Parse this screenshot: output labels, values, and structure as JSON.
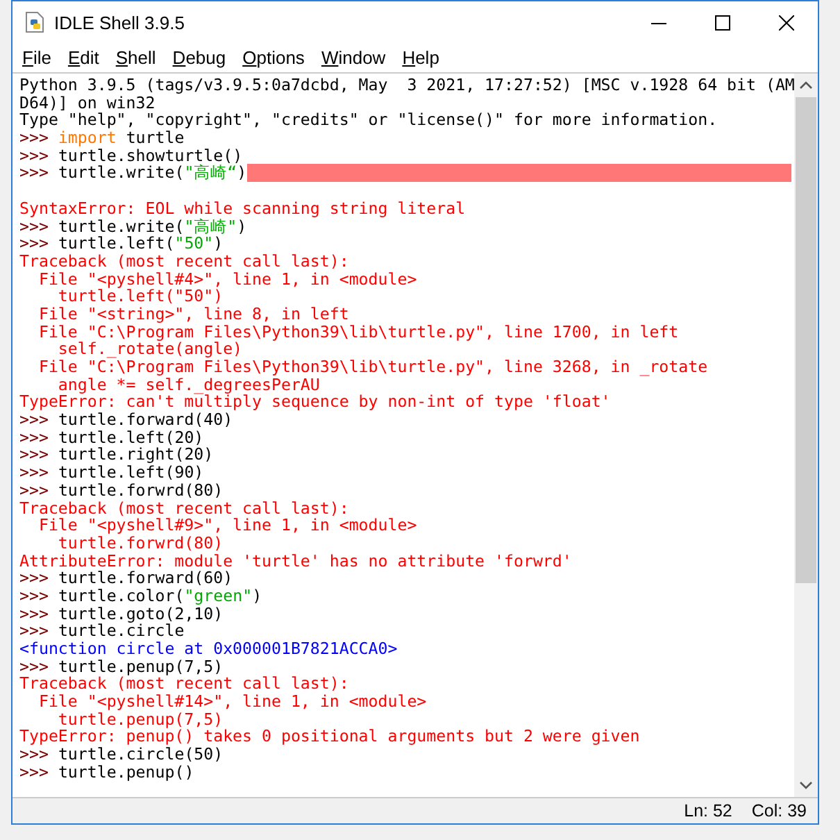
{
  "window": {
    "title": "IDLE Shell 3.9.5"
  },
  "menu": [
    "File",
    "Edit",
    "Shell",
    "Debug",
    "Options",
    "Window",
    "Help"
  ],
  "lines": [
    {
      "segments": [
        {
          "kind": "info",
          "text": "Python 3.9.5 (tags/v3.9.5:0a7dcbd, May  3 2021, 17:27:52) [MSC v.1928 64 bit (AM"
        }
      ]
    },
    {
      "segments": [
        {
          "kind": "info",
          "text": "D64)] on win32"
        }
      ]
    },
    {
      "segments": [
        {
          "kind": "info",
          "text": "Type \"help\", \"copyright\", \"credits\" or \"license()\" for more information."
        }
      ]
    },
    {
      "prompt": ">>>",
      "segments": [
        {
          "kind": "keyword",
          "text": "import"
        },
        {
          "kind": "code",
          "text": " turtle"
        }
      ]
    },
    {
      "prompt": ">>>",
      "segments": [
        {
          "kind": "code",
          "text": "turtle.showturtle()"
        }
      ]
    },
    {
      "prompt": ">>>",
      "segments": [
        {
          "kind": "code",
          "text": "turtle.write("
        },
        {
          "kind": "string",
          "text": "\"高崎“"
        },
        {
          "kind": "code",
          "text": ")"
        },
        {
          "kind": "error_mark"
        }
      ],
      "blank_line_after": true
    },
    {
      "segments": [
        {
          "kind": "error",
          "text": "SyntaxError: EOL while scanning string literal"
        }
      ]
    },
    {
      "prompt": ">>>",
      "segments": [
        {
          "kind": "code",
          "text": "turtle.write("
        },
        {
          "kind": "string",
          "text": "\"高崎\""
        },
        {
          "kind": "code",
          "text": ")"
        }
      ]
    },
    {
      "prompt": ">>>",
      "segments": [
        {
          "kind": "code",
          "text": "turtle.left("
        },
        {
          "kind": "string",
          "text": "\"50\""
        },
        {
          "kind": "code",
          "text": ")"
        }
      ]
    },
    {
      "segments": [
        {
          "kind": "error",
          "text": "Traceback (most recent call last):"
        }
      ]
    },
    {
      "segments": [
        {
          "kind": "error",
          "text": "  File \"<pyshell#4>\", line 1, in <module>"
        }
      ]
    },
    {
      "segments": [
        {
          "kind": "error",
          "text": "    turtle.left(\"50\")"
        }
      ]
    },
    {
      "segments": [
        {
          "kind": "error",
          "text": "  File \"<string>\", line 8, in left"
        }
      ]
    },
    {
      "segments": [
        {
          "kind": "error",
          "text": "  File \"C:\\Program Files\\Python39\\lib\\turtle.py\", line 1700, in left"
        }
      ]
    },
    {
      "segments": [
        {
          "kind": "error",
          "text": "    self._rotate(angle)"
        }
      ]
    },
    {
      "segments": [
        {
          "kind": "error",
          "text": "  File \"C:\\Program Files\\Python39\\lib\\turtle.py\", line 3268, in _rotate"
        }
      ]
    },
    {
      "segments": [
        {
          "kind": "error",
          "text": "    angle *= self._degreesPerAU"
        }
      ]
    },
    {
      "segments": [
        {
          "kind": "error",
          "text": "TypeError: can't multiply sequence by non-int of type 'float'"
        }
      ]
    },
    {
      "prompt": ">>>",
      "segments": [
        {
          "kind": "code",
          "text": "turtle.forward(40)"
        }
      ]
    },
    {
      "prompt": ">>>",
      "segments": [
        {
          "kind": "code",
          "text": "turtle.left(20)"
        }
      ]
    },
    {
      "prompt": ">>>",
      "segments": [
        {
          "kind": "code",
          "text": "turtle.right(20)"
        }
      ]
    },
    {
      "prompt": ">>>",
      "segments": [
        {
          "kind": "code",
          "text": "turtle.left(90)"
        }
      ]
    },
    {
      "prompt": ">>>",
      "segments": [
        {
          "kind": "code",
          "text": "turtle.forwrd(80)"
        }
      ]
    },
    {
      "segments": [
        {
          "kind": "error",
          "text": "Traceback (most recent call last):"
        }
      ]
    },
    {
      "segments": [
        {
          "kind": "error",
          "text": "  File \"<pyshell#9>\", line 1, in <module>"
        }
      ]
    },
    {
      "segments": [
        {
          "kind": "error",
          "text": "    turtle.forwrd(80)"
        }
      ]
    },
    {
      "segments": [
        {
          "kind": "error",
          "text": "AttributeError: module 'turtle' has no attribute 'forwrd'"
        }
      ]
    },
    {
      "prompt": ">>>",
      "segments": [
        {
          "kind": "code",
          "text": "turtle.forward(60)"
        }
      ]
    },
    {
      "prompt": ">>>",
      "segments": [
        {
          "kind": "code",
          "text": "turtle.color("
        },
        {
          "kind": "string",
          "text": "\"green\""
        },
        {
          "kind": "code",
          "text": ")"
        }
      ]
    },
    {
      "prompt": ">>>",
      "segments": [
        {
          "kind": "code",
          "text": "turtle.goto(2,10)"
        }
      ]
    },
    {
      "prompt": ">>>",
      "segments": [
        {
          "kind": "code",
          "text": "turtle.circle"
        }
      ]
    },
    {
      "segments": [
        {
          "kind": "output",
          "text": "<function circle at 0x000001B7821ACCA0>"
        }
      ]
    },
    {
      "prompt": ">>>",
      "segments": [
        {
          "kind": "code",
          "text": "turtle.penup(7,5)"
        }
      ]
    },
    {
      "segments": [
        {
          "kind": "error",
          "text": "Traceback (most recent call last):"
        }
      ]
    },
    {
      "segments": [
        {
          "kind": "error",
          "text": "  File \"<pyshell#14>\", line 1, in <module>"
        }
      ]
    },
    {
      "segments": [
        {
          "kind": "error",
          "text": "    turtle.penup(7,5)"
        }
      ]
    },
    {
      "segments": [
        {
          "kind": "error",
          "text": "TypeError: penup() takes 0 positional arguments but 2 were given"
        }
      ]
    },
    {
      "prompt": ">>>",
      "segments": [
        {
          "kind": "code",
          "text": "turtle.circle(50)"
        }
      ]
    },
    {
      "prompt": ">>>",
      "segments": [
        {
          "kind": "code",
          "text": "turtle.penup()"
        }
      ]
    }
  ],
  "status_bar": {
    "line": "Ln: 52",
    "column": "Col: 39"
  }
}
